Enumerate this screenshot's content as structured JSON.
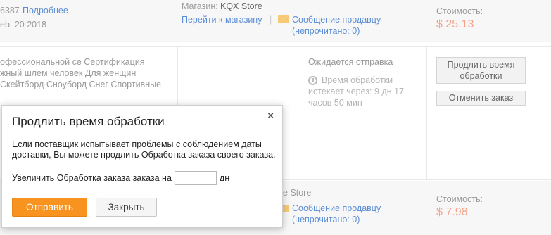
{
  "order1": {
    "order_id_fragment": "6387",
    "details_link": "Подробнее",
    "date": "eb. 20 2018",
    "store_prefix": "Магазин:",
    "store_name": "KQX Store",
    "store_link": "Перейти к магазину",
    "separator": "|",
    "message_link": "Сообщение продавцу",
    "message_unread": "(непрочитано: 0)",
    "cost_label": "Стоимость:",
    "cost_value": "$ 25.13"
  },
  "order2": {
    "product_lines": [
      "офессиональной се Сертификация",
      "жный шлем человек Для женщин",
      "Скейтборд Сноуборд Снег Спортивные"
    ],
    "status": "Ожидается отправка",
    "processing_line1": "Время обработки",
    "processing_line2": "истекает через: 9 дн 17",
    "processing_line3": "часов 50 мин",
    "extend_button_line1": "Продлить время",
    "extend_button_line2": "обработки",
    "cancel_button": "Отменить заказ"
  },
  "order3": {
    "store_fragment": "e Store",
    "message_link": "Сообщение продавцу",
    "message_unread": "(непрочитано: 0)",
    "cost_label": "Стоимость:",
    "cost_value": "$ 7.98"
  },
  "modal": {
    "title": "Продлить время обработки",
    "close": "×",
    "description": "Если поставщик испытывает проблемы с соблюдением даты доставки, Вы можете продлить Обработка заказа своего заказа.",
    "extend_label": "Увеличить Обработка заказа заказа на",
    "days_value": "",
    "days_unit": "дн",
    "submit_label": "Отправить",
    "close_label": "Закрыть"
  },
  "colors": {
    "primary_button": "#f7931e",
    "link": "#5b8ed6",
    "price": "#f4a38a"
  }
}
